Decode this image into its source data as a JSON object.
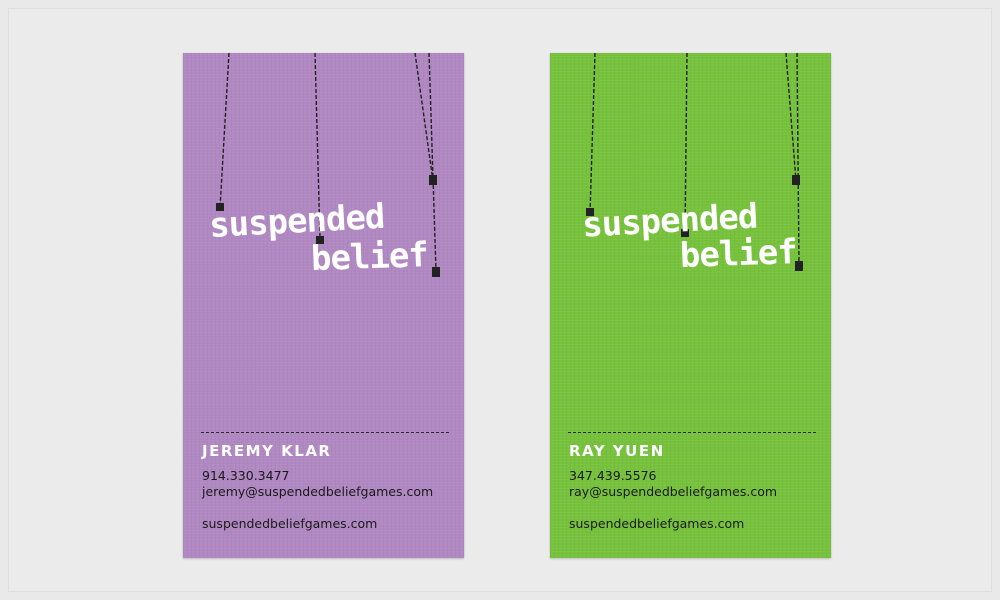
{
  "cards": [
    {
      "color": "#b088c2",
      "logo": {
        "line1": "suspended",
        "line2": "belief"
      },
      "name": "JEREMY KLAR",
      "phone": "914.330.3477",
      "email": "jeremy@suspendedbeliefgames.com",
      "website": "suspendedbeliefgames.com"
    },
    {
      "color": "#77c23c",
      "logo": {
        "line1": "suspended",
        "line2": "belief"
      },
      "name": "RAY YUEN",
      "phone": "347.439.5576",
      "email": "ray@suspendedbeliefgames.com",
      "website": "suspendedbeliefgames.com"
    }
  ]
}
